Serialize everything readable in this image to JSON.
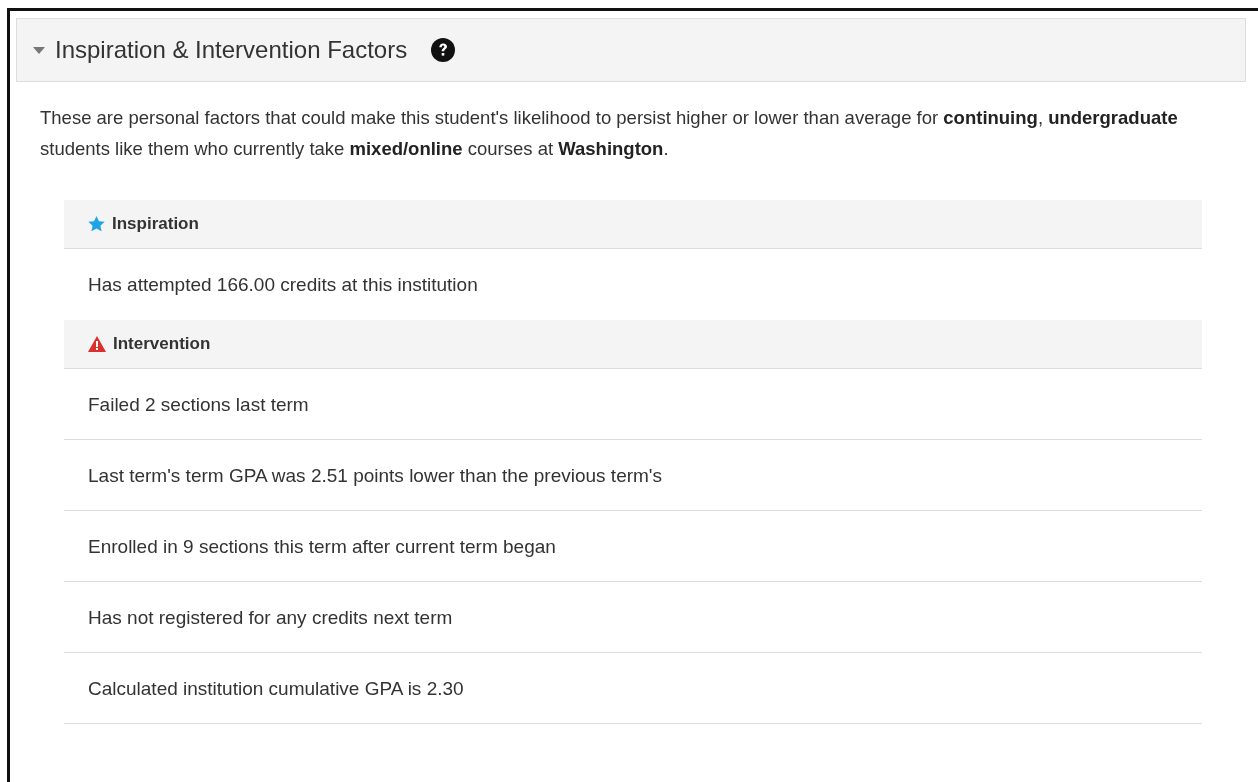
{
  "panel": {
    "title": "Inspiration & Intervention Factors",
    "expanded": true
  },
  "description": "These are personal factors that could make this student's likelihood to persist higher or lower than average for **continuing**, **undergraduate** students like them who currently take **mixed/online** courses at **Washington**.",
  "groups": [
    {
      "kind": "inspiration",
      "label": "Inspiration",
      "items": [
        "Has attempted 166.00 credits at this institution"
      ]
    },
    {
      "kind": "intervention",
      "label": "Intervention",
      "items": [
        "Failed 2 sections last term",
        "Last term's term GPA was 2.51 points lower than the previous term's",
        "Enrolled in 9 sections this term after current term began",
        "Has not registered for any credits next term",
        "Calculated institution cumulative GPA is 2.30"
      ]
    }
  ]
}
